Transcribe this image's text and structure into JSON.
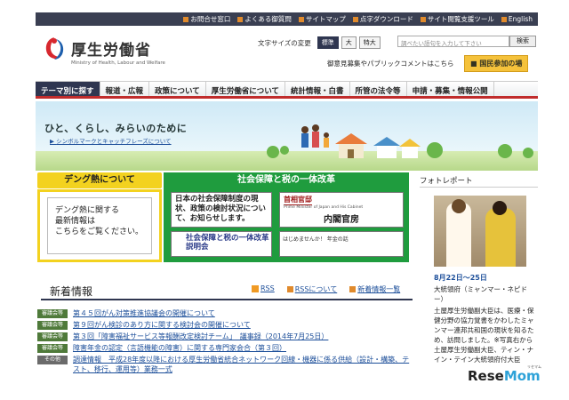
{
  "topbar": {
    "links": [
      "お問合せ窓口",
      "よくある御質問",
      "サイトマップ",
      "点字ダウンロード",
      "サイト閲覧支援ツール",
      "English"
    ]
  },
  "header": {
    "title": "厚生労働省",
    "subtitle": "Ministry of Health, Labour and Welfare",
    "font_size_label": "文字サイズの変更",
    "font_sizes": [
      "標準",
      "大",
      "特大"
    ],
    "search_placeholder": "調べたい語句を入力して下さい",
    "search_button": "検索",
    "public_comment": "御意見募集やパブリックコメントはこちら",
    "kokumin_button": "国民参加の場"
  },
  "nav": [
    "テーマ別に探す",
    "報道・広報",
    "政策について",
    "厚生労働省について",
    "統計情報・白書",
    "所管の法令等",
    "申請・募集・情報公開"
  ],
  "hero": {
    "slogan": "ひと、くらし、みらいのために",
    "link": "シンボルマークとキャッチフレーズについて"
  },
  "dengue": {
    "title": "デング熱について",
    "lines": [
      "デング熱に関する",
      "最新情報は",
      "こちらをご覧ください。"
    ]
  },
  "shakai": {
    "title": "社会保障と税の一体改革",
    "box1": "日本の社会保障制度の現状、政策の検討状況について、お知らせします。",
    "box2": "社会保障と税の一体改革説明会",
    "box3_title": "首相官邸",
    "box3_en": "Prime Minister of Japan and His Cabinet",
    "box3_name": "内閣官房",
    "box4": "はじめませんか！ 年金の話"
  },
  "photo": {
    "title": "フォトレポート",
    "date": "8月22日～25日",
    "caption": "大統領府（ミャンマー・ネピドー）",
    "body": "土屋厚生労働副大臣は、医療・保健分野の協力覚書をかわしたミャンマー連邦共和国の現状を知るため、訪問しました。※写真右から　土屋厚生労働副大臣、ティン・ナイン・テイン大統領府付大臣"
  },
  "news": {
    "title": "新着情報",
    "rss": "RSS",
    "rss_about": "RSSについて",
    "all": "新着情報一覧",
    "items": [
      {
        "badge": "審議会等",
        "badge_color": "#4f7a3a",
        "text": "第４５回がん対策推進協議会の開催について"
      },
      {
        "badge": "審議会等",
        "badge_color": "#4f7a3a",
        "text": "第９回がん検診のあり方に関する検討会の開催について"
      },
      {
        "badge": "審議会等",
        "badge_color": "#4f7a3a",
        "text": "第３回「障害福祉サービス等報酬改定検討チーム」　議事録（2014年7月25日）"
      },
      {
        "badge": "審議会等",
        "badge_color": "#4f7a3a",
        "text": "障害年金の認定（言語機能の障害）に関する専門家会合（第３回）"
      },
      {
        "badge": "その他",
        "badge_color": "#6b6b6b",
        "text": "調達情報　平成28年度以降における厚生労働省統合ネットワーク回線・機器に係る供給（設計・構築、テスト、移行、運用等）業務一式"
      }
    ]
  },
  "watermark": {
    "resemom_a": "Rese",
    "resemom_b": "Mom",
    "sub": "リセマム"
  }
}
